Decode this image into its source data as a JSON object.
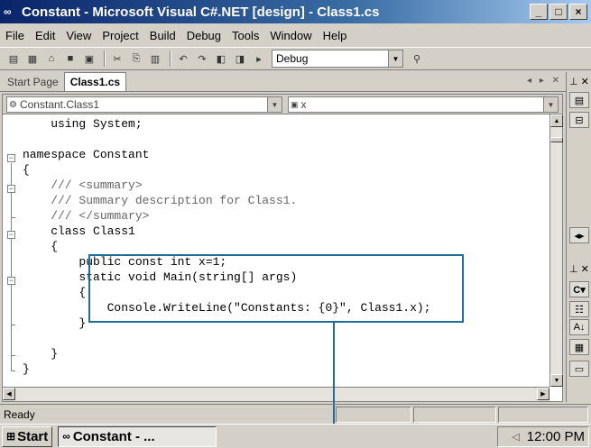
{
  "window": {
    "title": "Constant - Microsoft Visual C#.NET [design] - Class1.cs",
    "buttons": [
      "_",
      "□",
      "×"
    ]
  },
  "menu": [
    {
      "label": "File"
    },
    {
      "label": "Edit"
    },
    {
      "label": "View"
    },
    {
      "label": "Project"
    },
    {
      "label": "Build"
    },
    {
      "label": "Debug"
    },
    {
      "label": "Tools"
    },
    {
      "label": "Window"
    },
    {
      "label": "Help"
    }
  ],
  "toolbar": {
    "config_value": "Debug",
    "icons": [
      "new-project-icon",
      "add-item-icon",
      "open-icon",
      "save-icon",
      "save-all-icon",
      "cut-icon",
      "copy-icon",
      "paste-icon",
      "undo-icon",
      "redo-icon",
      "navigate-back-icon",
      "navigate-forward-icon",
      "start-icon",
      "find-icon"
    ]
  },
  "tabs": [
    {
      "label": "Start Page",
      "active": false
    },
    {
      "label": "Class1.cs",
      "active": true
    }
  ],
  "nav": {
    "type_combo": "Constant.Class1",
    "member_combo": "x"
  },
  "code": {
    "lines": [
      {
        "text": "    using System;",
        "style": "kw"
      },
      {
        "text": "",
        "style": "kw"
      },
      {
        "text": "namespace Constant",
        "style": "kw"
      },
      {
        "text": "{",
        "style": "kw"
      },
      {
        "text": "    /// <summary>",
        "style": "cm"
      },
      {
        "text": "    /// Summary description for Class1.",
        "style": "cm"
      },
      {
        "text": "    /// </summary>",
        "style": "cm"
      },
      {
        "text": "    class Class1",
        "style": "kw"
      },
      {
        "text": "    {",
        "style": "kw"
      },
      {
        "text": "        public const int x=1;",
        "style": "kw"
      },
      {
        "text": "        static void Main(string[] args)",
        "style": "kw"
      },
      {
        "text": "        {",
        "style": "kw"
      },
      {
        "text": "            Console.WriteLine(\"Constants: {0}\", Class1.x);",
        "style": "kw"
      },
      {
        "text": "        }",
        "style": "kw"
      },
      {
        "text": "",
        "style": "kw"
      },
      {
        "text": "    }",
        "style": "kw"
      },
      {
        "text": "}",
        "style": "kw"
      }
    ]
  },
  "status": {
    "text": "Ready"
  },
  "taskbar": {
    "start_label": "Start",
    "task_label": "Constant - ...",
    "clock": "12:00 PM"
  },
  "colors": {
    "title_start": "#0a246a",
    "title_end": "#a6caf0",
    "callout": "#1f6e9a"
  }
}
